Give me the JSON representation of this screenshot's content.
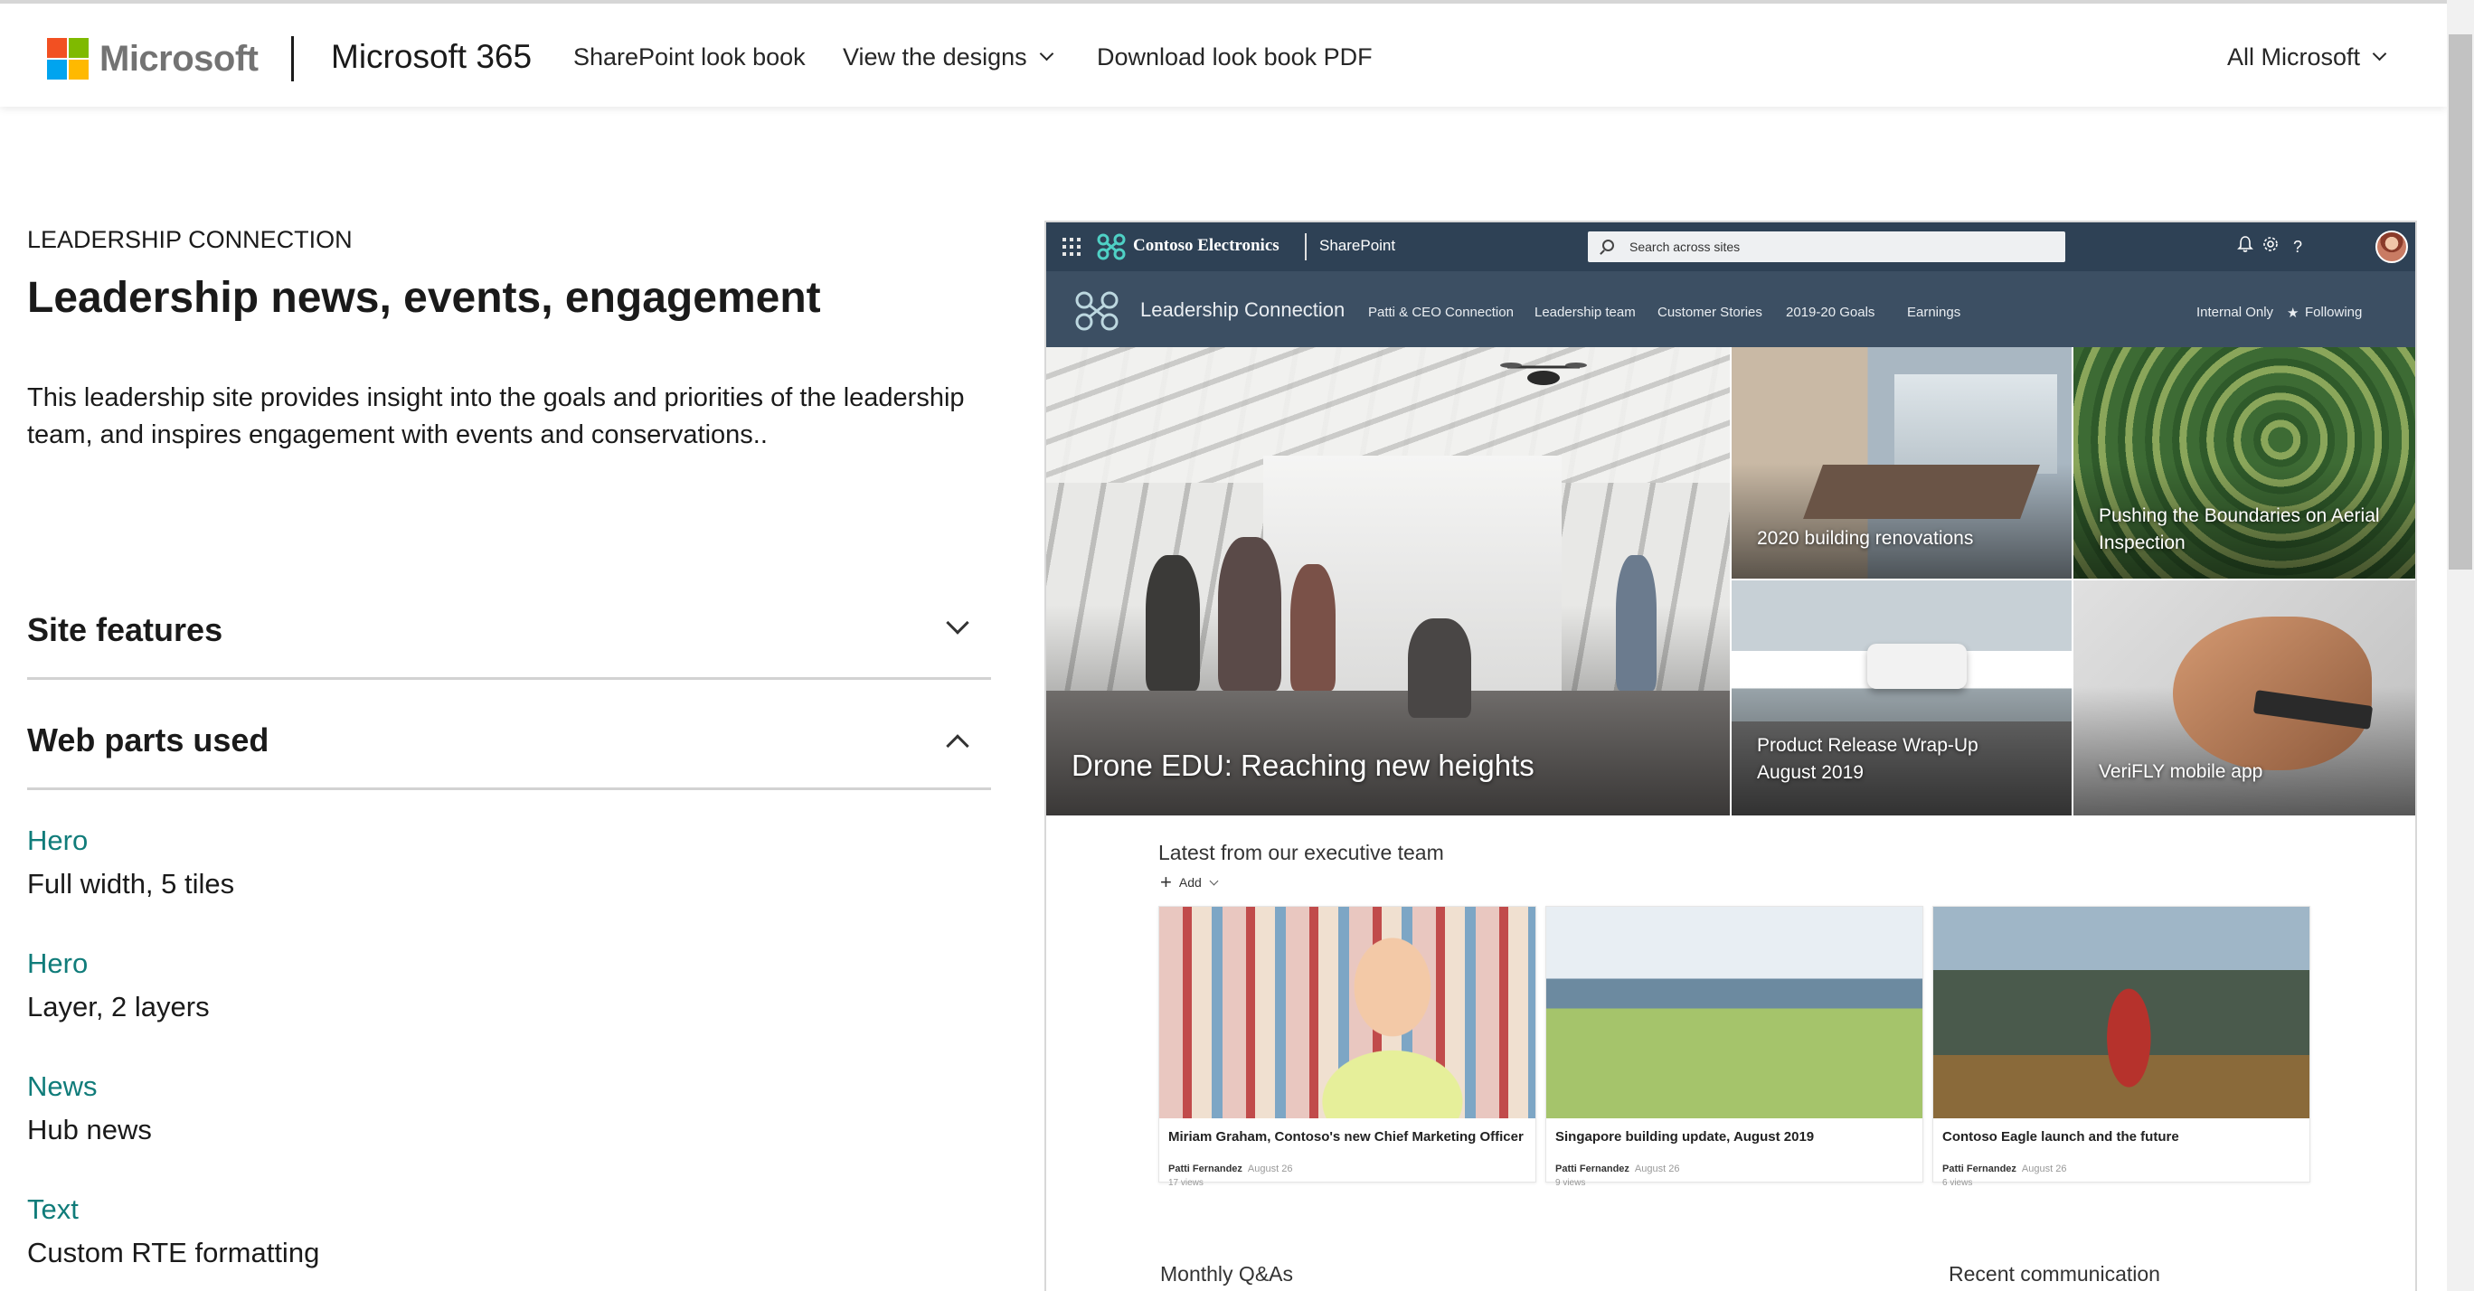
{
  "topnav": {
    "brand_logo_text": "Microsoft",
    "product": "Microsoft 365",
    "links": [
      "SharePoint look book",
      "View the designs",
      "Download look book PDF"
    ],
    "all_microsoft": "All Microsoft"
  },
  "left": {
    "eyebrow": "LEADERSHIP CONNECTION",
    "title": "Leadership news, events, engagement",
    "description": "This leadership site provides insight into the goals and priorities of the leadership team, and inspires engagement with events and conservations..",
    "accordions": [
      {
        "title": "Site features",
        "expanded": false
      },
      {
        "title": "Web parts used",
        "expanded": true
      }
    ],
    "web_parts": [
      {
        "name": "Hero",
        "desc": "Full width, 5 tiles"
      },
      {
        "name": "Hero",
        "desc": "Layer, 2 layers"
      },
      {
        "name": "News",
        "desc": "Hub news"
      },
      {
        "name": "Text",
        "desc": "Custom RTE formatting"
      }
    ]
  },
  "mock": {
    "suite": {
      "company": "Contoso Electronics",
      "app": "SharePoint",
      "search_placeholder": "Search across sites",
      "icons": [
        "bell-icon",
        "gear-icon",
        "help-icon"
      ]
    },
    "site": {
      "title": "Leadership Connection",
      "nav": [
        "Patti & CEO Connection",
        "Leadership team",
        "Customer Stories",
        "2019-20 Goals",
        "Earnings"
      ],
      "internal": "Internal Only",
      "following": "Following"
    },
    "hero": {
      "main": "Drone EDU: Reaching new heights",
      "tiles": [
        "2020 building renovations",
        "Pushing the Boundaries on Aerial Inspection",
        "Product Release Wrap-Up August 2019",
        "VeriFLY mobile app"
      ]
    },
    "news": {
      "heading": "Latest from our executive team",
      "add_label": "Add",
      "items": [
        {
          "title": "Miriam Graham, Contoso's new Chief Marketing Officer",
          "author": "Patti Fernandez",
          "date": "August 26",
          "views": "17 views"
        },
        {
          "title": "Singapore building update, August 2019",
          "author": "Patti Fernandez",
          "date": "August 26",
          "views": "9 views"
        },
        {
          "title": "Contoso Eagle launch and the future",
          "author": "Patti Fernandez",
          "date": "August 26",
          "views": "6 views"
        }
      ]
    },
    "sections": [
      "Monthly Q&As",
      "Recent communication"
    ]
  },
  "colors": {
    "accent_teal": "#107c7a",
    "suite_bar": "#2e4155",
    "site_header": "#3c4f63"
  }
}
